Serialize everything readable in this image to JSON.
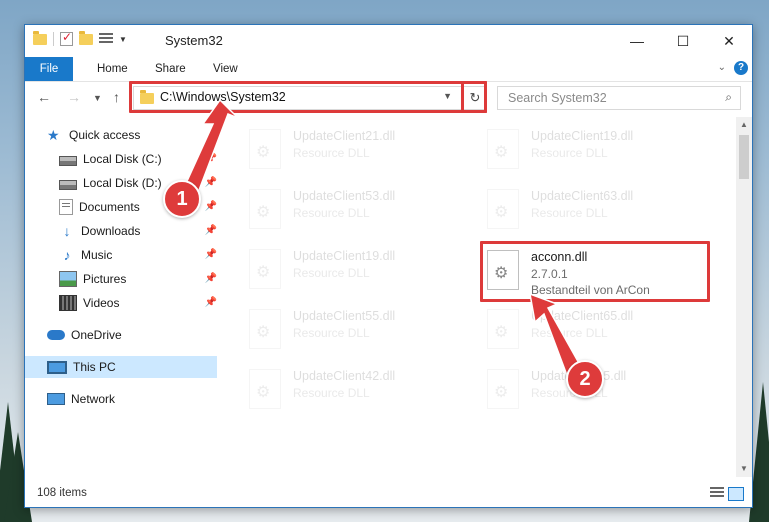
{
  "window": {
    "title": "System32",
    "controls": {
      "minimize": "—",
      "maximize": "☐",
      "close": "✕"
    }
  },
  "ribbon": {
    "tabs": [
      "File",
      "Home",
      "Share",
      "View"
    ]
  },
  "address_bar": {
    "path": "C:\\Windows\\System32",
    "search_placeholder": "Search System32"
  },
  "sidebar": {
    "items": [
      {
        "label": "Quick access",
        "icon": "star-icon",
        "pinned": false
      },
      {
        "label": "Local Disk (C:)",
        "icon": "drive-icon",
        "pinned": true
      },
      {
        "label": "Local Disk (D:)",
        "icon": "drive-icon",
        "pinned": true
      },
      {
        "label": "Documents",
        "icon": "documents-icon",
        "pinned": true
      },
      {
        "label": "Downloads",
        "icon": "download-icon",
        "pinned": true
      },
      {
        "label": "Music",
        "icon": "music-icon",
        "pinned": true
      },
      {
        "label": "Pictures",
        "icon": "pictures-icon",
        "pinned": true
      },
      {
        "label": "Videos",
        "icon": "videos-icon",
        "pinned": true
      },
      {
        "label": "OneDrive",
        "icon": "cloud-icon",
        "pinned": false
      },
      {
        "label": "This PC",
        "icon": "computer-icon",
        "pinned": false,
        "selected": true
      },
      {
        "label": "Network",
        "icon": "network-icon",
        "pinned": false
      }
    ]
  },
  "files": {
    "left_column": [
      {
        "name": "UpdateClient21.dll",
        "desc": "Resource DLL"
      },
      {
        "name": "UpdateClient53.dll",
        "desc": "Resource DLL"
      },
      {
        "name": "UpdateClient19.dll",
        "desc": "Resource DLL"
      },
      {
        "name": "UpdateClient55.dll",
        "desc": "Resource DLL"
      },
      {
        "name": "UpdateClient42.dll",
        "desc": "Resource DLL"
      }
    ],
    "right_column": [
      {
        "name": "UpdateClient19.dll",
        "desc": "Resource DLL"
      },
      {
        "name": "UpdateClient63.dll",
        "desc": "Resource DLL"
      },
      {
        "name": "UpdateClient65.dll",
        "desc": "Resource DLL"
      },
      {
        "name": "UpdateClient5.dll",
        "desc": "Resource DLL"
      }
    ],
    "highlighted": {
      "name": "acconn.dll",
      "version": "2.7.0.1",
      "description": "Bestandteil von ArCon"
    }
  },
  "status": {
    "item_count": "108 items"
  },
  "callouts": {
    "step1": "1",
    "step2": "2",
    "color": "#de3b3b"
  }
}
